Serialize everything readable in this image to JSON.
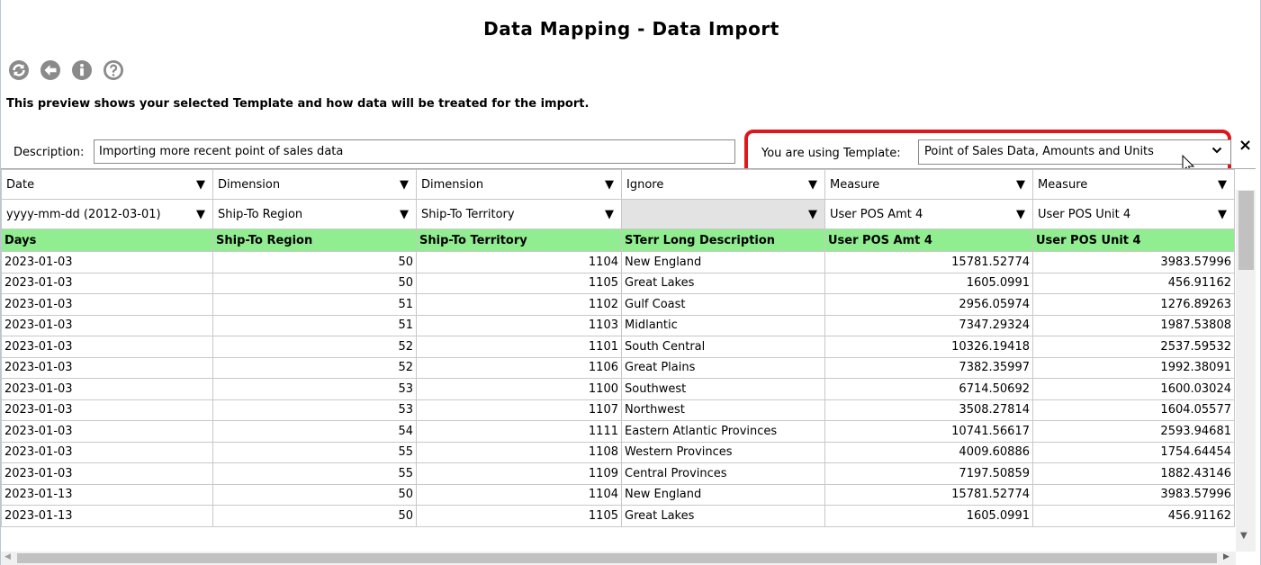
{
  "window": {
    "title": "Data Mapping - Data Import",
    "preview_note": "This preview shows your selected Template and how data will be treated for the import."
  },
  "toolbar": {
    "icons": [
      "refresh-icon",
      "back-icon",
      "info-icon",
      "help-icon"
    ]
  },
  "description": {
    "label": "Description:",
    "value": "Importing more recent point of sales data"
  },
  "template": {
    "label": "You are using Template:",
    "selected": "Point of Sales Data, Amounts and Units",
    "highlight_color": "#e0161d",
    "close": "×"
  },
  "grid": {
    "type_row": [
      {
        "value": "Date",
        "arrow": "▼"
      },
      {
        "value": "Dimension",
        "arrow": "▼"
      },
      {
        "value": "Dimension",
        "arrow": "▼"
      },
      {
        "value": "Ignore",
        "arrow": "▼"
      },
      {
        "value": "Measure",
        "arrow": "▼"
      },
      {
        "value": "Measure",
        "arrow": "▼"
      }
    ],
    "map_row": [
      {
        "value": "yyyy-mm-dd (2012-03-01)",
        "arrow": "▼"
      },
      {
        "value": "Ship-To Region",
        "arrow": "▼"
      },
      {
        "value": "Ship-To Territory",
        "arrow": "▼"
      },
      {
        "value": "",
        "arrow": "▼"
      },
      {
        "value": "User POS Amt 4",
        "arrow": "▼"
      },
      {
        "value": "User POS Unit 4",
        "arrow": "▼"
      }
    ],
    "header_color": "#90ee90",
    "headers": [
      "Days",
      "Ship-To Region",
      "Ship-To Territory",
      "STerr Long Description",
      "User POS Amt 4",
      "User POS Unit 4"
    ],
    "rows": [
      [
        "2023-01-03",
        "50",
        "1104",
        "New England",
        "15781.52774",
        "3983.57996"
      ],
      [
        "2023-01-03",
        "50",
        "1105",
        "Great Lakes",
        "1605.0991",
        "456.91162"
      ],
      [
        "2023-01-03",
        "51",
        "1102",
        "Gulf Coast",
        "2956.05974",
        "1276.89263"
      ],
      [
        "2023-01-03",
        "51",
        "1103",
        "Midlantic",
        "7347.29324",
        "1987.53808"
      ],
      [
        "2023-01-03",
        "52",
        "1101",
        "South Central",
        "10326.19418",
        "2537.59532"
      ],
      [
        "2023-01-03",
        "52",
        "1106",
        "Great Plains",
        "7382.35997",
        "1992.38091"
      ],
      [
        "2023-01-03",
        "53",
        "1100",
        "Southwest",
        "6714.50692",
        "1600.03024"
      ],
      [
        "2023-01-03",
        "53",
        "1107",
        "Northwest",
        "3508.27814",
        "1604.05577"
      ],
      [
        "2023-01-03",
        "54",
        "1111",
        "Eastern Atlantic Provinces",
        "10741.56617",
        "2593.94681"
      ],
      [
        "2023-01-03",
        "55",
        "1108",
        "Western Provinces",
        "4009.60886",
        "1754.64454"
      ],
      [
        "2023-01-03",
        "55",
        "1109",
        "Central Provinces",
        "7197.50859",
        "1882.43146"
      ],
      [
        "2023-01-13",
        "50",
        "1104",
        "New England",
        "15781.52774",
        "3983.57996"
      ],
      [
        "2023-01-13",
        "50",
        "1105",
        "Great Lakes",
        "1605.0991",
        "456.91162"
      ]
    ]
  }
}
